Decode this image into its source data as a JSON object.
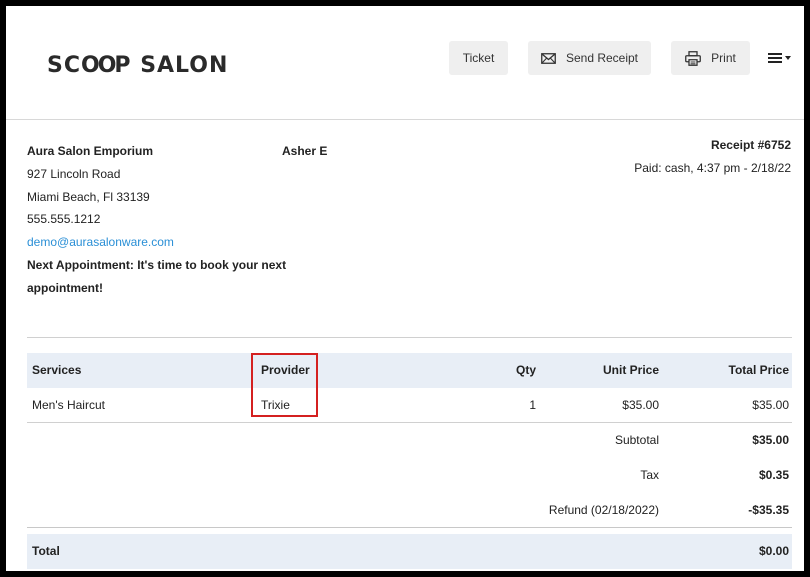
{
  "brand": {
    "logo_pre": "SC",
    "logo_oo": "OO",
    "logo_post": "P SALON"
  },
  "toolbar": {
    "ticket_label": "Ticket",
    "send_receipt_label": "Send Receipt",
    "print_label": "Print"
  },
  "salon": {
    "name": "Aura Salon Emporium",
    "address1": "927 Lincoln Road",
    "address2": "Miami Beach, Fl 33139",
    "phone": "555.555.1212",
    "email": "demo@aurasalonware.com",
    "next_appt_1": "Next Appointment: It's time to book your next",
    "next_appt_2": "appointment!"
  },
  "client": {
    "name": "Asher E"
  },
  "receipt": {
    "number": "Receipt #6752",
    "paid": "Paid: cash, 4:37 pm - 2/18/22"
  },
  "table": {
    "headers": {
      "services": "Services",
      "provider": "Provider",
      "qty": "Qty",
      "unit_price": "Unit Price",
      "total_price": "Total Price"
    },
    "rows": [
      {
        "service": "Men's Haircut",
        "provider": "Trixie",
        "qty": "1",
        "unit_price": "$35.00",
        "total_price": "$35.00"
      }
    ],
    "subtotal_label": "Subtotal",
    "subtotal_value": "$35.00",
    "tax_label": "Tax",
    "tax_value": "$0.35",
    "refund_label": "Refund (02/18/2022)",
    "refund_value": "-$35.35",
    "total_label": "Total",
    "total_value": "$0.00"
  },
  "colors": {
    "link": "#2a8fd6",
    "header_row": "#e8eef6",
    "highlight": "#d42020",
    "button_bg": "#efefef"
  }
}
